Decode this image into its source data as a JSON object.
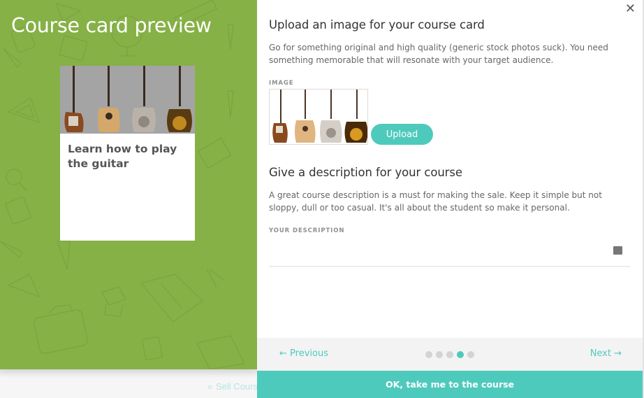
{
  "background_page": {
    "link_text": "Sell Cours"
  },
  "preview": {
    "title": "Course card preview",
    "card": {
      "image_alt": "four guitars",
      "title": "Learn how to play the guitar"
    }
  },
  "modal": {
    "close_icon": "close-icon",
    "image_section": {
      "heading": "Upload an image for your course card",
      "description": "Go for something original and high quality (generic stock photos suck). You need something memorable that will resonate with your target audience.",
      "label": "IMAGE",
      "upload_label": "Upload"
    },
    "description_section": {
      "heading": "Give a description for your course",
      "description": "A great course description is a must for making the sale. Keep it simple but not sloppy, dull or too casual. It's all about the student so make it personal.",
      "label": "YOUR DESCRIPTION",
      "value": "",
      "placeholder": ""
    },
    "footer": {
      "previous_label": "← Previous",
      "next_label": "Next →",
      "steps_total": 5,
      "current_step": 4
    },
    "ok_label": "OK, take me to the course"
  },
  "colors": {
    "accent": "#4ecabd",
    "panel_green": "#86b146"
  }
}
